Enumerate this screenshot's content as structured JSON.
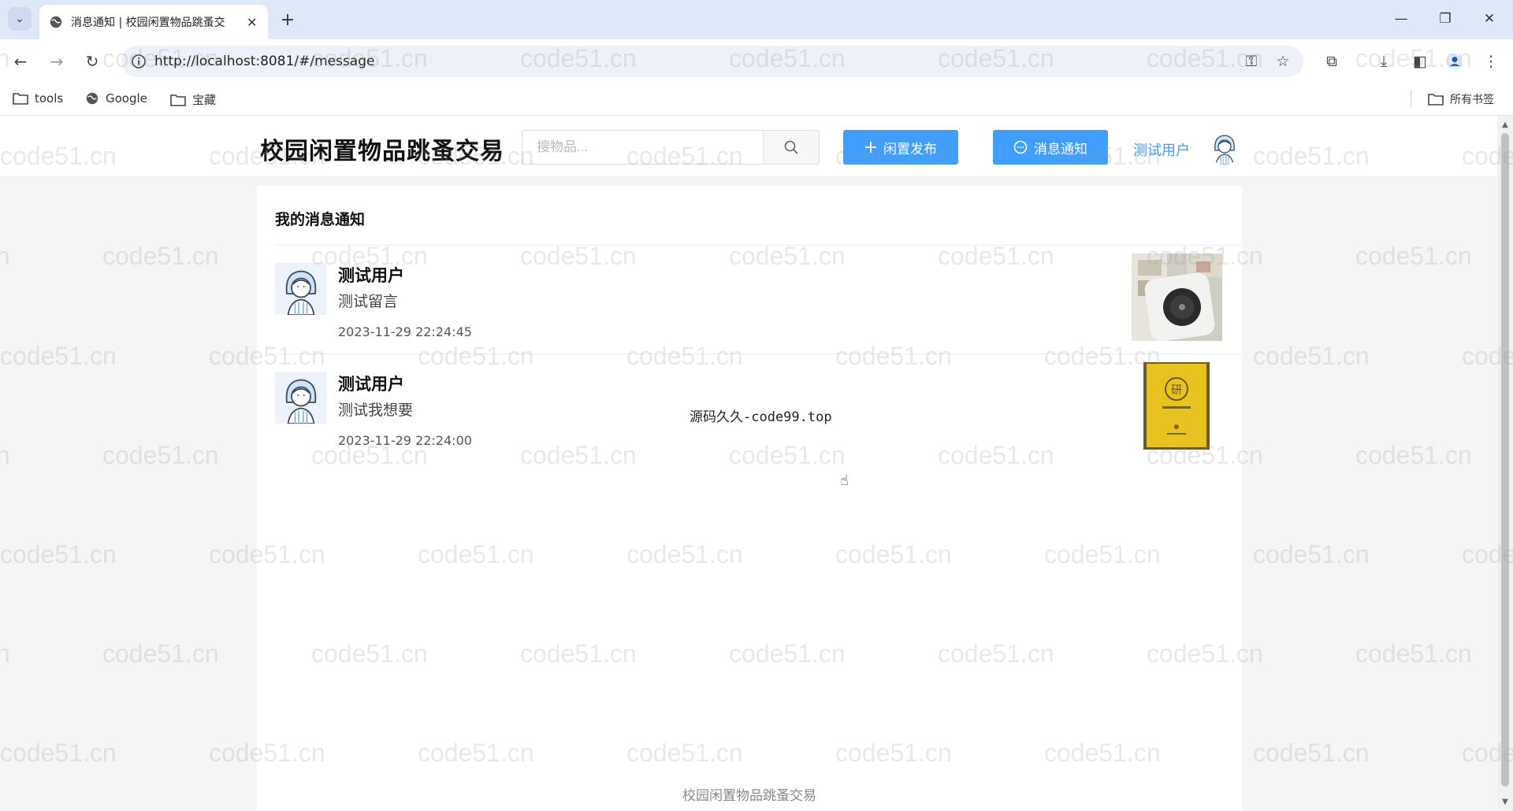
{
  "browser": {
    "tab_title": "消息通知 | 校园闲置物品跳蚤交",
    "url": "http://localhost:8081/#/message",
    "bookmarks": [
      {
        "label": "tools",
        "icon": "folder-icon"
      },
      {
        "label": "Google",
        "icon": "globe-icon"
      },
      {
        "label": "宝藏",
        "icon": "folder-icon"
      }
    ],
    "all_bookmarks": "所有书签"
  },
  "header": {
    "logo": "校园闲置物品跳蚤交易",
    "search_placeholder": "搜物品...",
    "publish_label": "闲置发布",
    "message_label": "消息通知",
    "user_name": "测试用户"
  },
  "main": {
    "section_title": "我的消息通知",
    "messages": [
      {
        "name": "测试用户",
        "text": "测试留言",
        "time": "2023-11-29 22:24:45",
        "thumb": "white speaker product photo"
      },
      {
        "name": "测试用户",
        "text": "测试我想要",
        "time": "2023-11-29 22:24:00",
        "thumb": "yellow book cover"
      }
    ]
  },
  "overlay_text": "源码久久-code99.top",
  "footer": "校园闲置物品跳蚤交易",
  "watermark": "code51.cn",
  "colors": {
    "primary": "#409eff",
    "chrome": "#dfe8f6",
    "background": "#f5f5f5"
  }
}
